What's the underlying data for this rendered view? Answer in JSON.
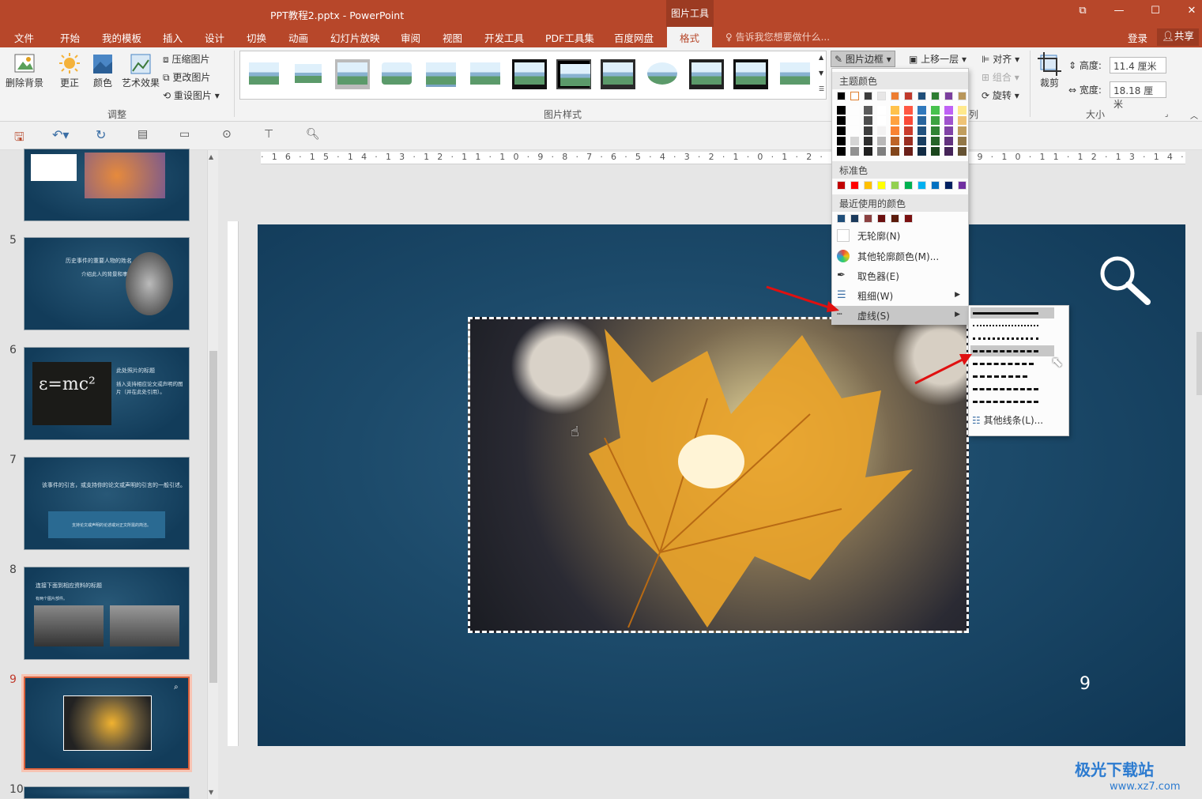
{
  "titlebar": {
    "doc_title": "PPT教程2.pptx - PowerPoint",
    "context_tab": "图片工具",
    "restore": "⧉",
    "minimize": "—",
    "maximize": "☐",
    "close": "✕"
  },
  "tabs": {
    "items": [
      "文件",
      "开始",
      "我的模板",
      "插入",
      "设计",
      "切换",
      "动画",
      "幻灯片放映",
      "审阅",
      "视图",
      "开发工具",
      "PDF工具集",
      "百度网盘",
      "格式"
    ],
    "tell_me": "告诉我您想要做什么...",
    "login": "登录",
    "share": "共享"
  },
  "ribbon": {
    "adjust": {
      "remove_bg": "删除背景",
      "correct": "更正",
      "color": "颜色",
      "artistic": "艺术效果",
      "compress": "压缩图片",
      "change": "更改图片",
      "reset": "重设图片",
      "group_label": "调整"
    },
    "styles": {
      "group_label": "图片样式"
    },
    "border_btn": "图片边框",
    "arrange": {
      "bring_forward": "上移一层",
      "align": "对齐",
      "group": "组合",
      "rotate": "旋转",
      "group_label_fragment": "列"
    },
    "size": {
      "crop": "裁剪",
      "height_label": "高度:",
      "height_value": "11.4 厘米",
      "width_label": "宽度:",
      "width_value": "18.18 厘米",
      "group_label": "大小"
    }
  },
  "ruler": {
    "h_ticks": "·16·15·14·13·12·11·10·9·8·7·6·5·4·3·2·1·0·1·2·3·4·5·6·7·8·9·10·11·12·13·14·15·16·"
  },
  "slides": [
    {
      "num": "",
      "title": "",
      "sub": ""
    },
    {
      "num": "5",
      "title": "历史事件的重要人物的姓名",
      "sub": "介绍此人的背景和事件的影响。"
    },
    {
      "num": "6",
      "title": "此处照片的标题",
      "sub": "插入支持相应论文或声明的图片（并在此处引用）。"
    },
    {
      "num": "7",
      "title": "该事件的引言，或支持你的论文或声明的引言的一般引述。",
      "sub": "支持论文或声明的论述或对正文所需的简洁。"
    },
    {
      "num": "8",
      "title": "连接下面到相应资料的标题",
      "sub": "有两个图片部件。"
    },
    {
      "num": "9",
      "title": "",
      "sub": ""
    },
    {
      "num": "10",
      "title": "",
      "sub": ""
    }
  ],
  "slide": {
    "page_number": "9"
  },
  "menu": {
    "theme_header": "主题颜色",
    "standard_header": "标准色",
    "recent_header": "最近使用的颜色",
    "no_outline": "无轮廓(N)",
    "more_colors": "其他轮廓颜色(M)...",
    "eyedropper": "取色器(E)",
    "weight": "粗细(W)",
    "dashes": "虚线(S)",
    "theme_top": [
      "#000000",
      "#ffffff",
      "#3b3b3b",
      "#e7e6e6",
      "#ed7d31",
      "#c0392b",
      "#1f4e79",
      "#2e7d32",
      "#7b3f9e",
      "#b8965a"
    ],
    "standard": [
      "#c00000",
      "#ff0000",
      "#ffc000",
      "#ffff00",
      "#92d050",
      "#00b050",
      "#00b0f0",
      "#0070c0",
      "#002060",
      "#7030a0"
    ],
    "recent": [
      "#1f4e79",
      "#1b3a5c",
      "#8b4040",
      "#6b0f0f",
      "#5a1a0a",
      "#7a1010"
    ]
  },
  "submenu": {
    "more_lines": "其他线条(L)..."
  },
  "watermark": {
    "brand": "极光下载站",
    "url": "www.xz7.com"
  }
}
